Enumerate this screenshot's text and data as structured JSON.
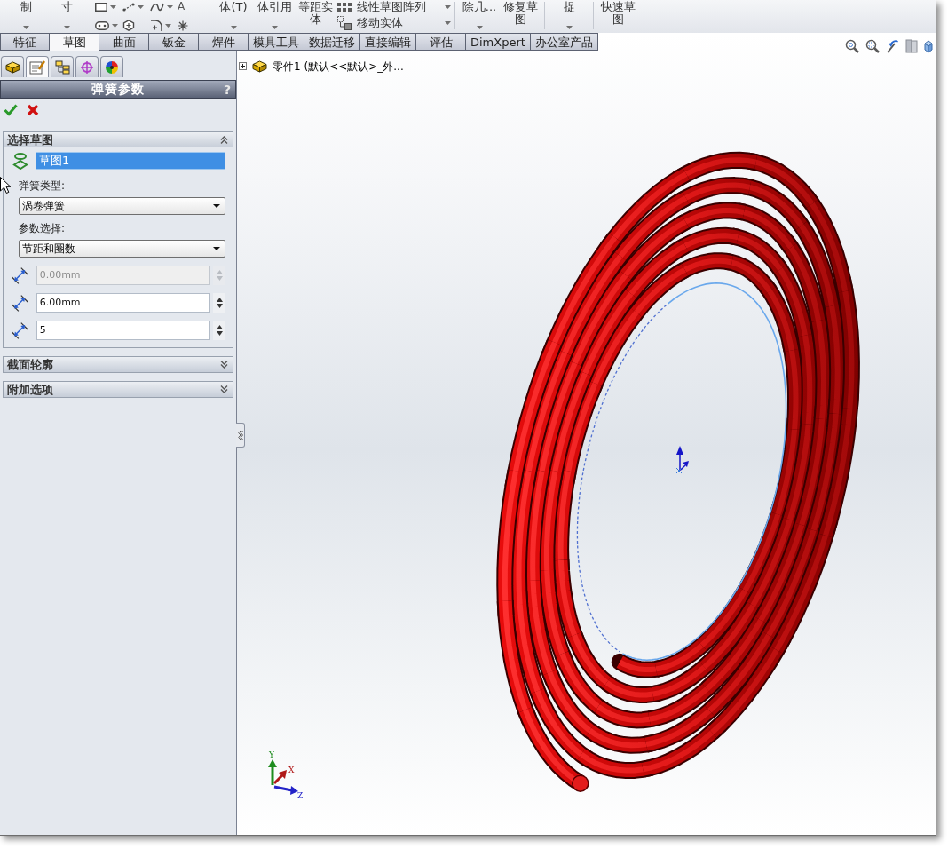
{
  "ribbon": [
    {
      "kind": "large",
      "label": "制",
      "caret": true
    },
    {
      "kind": "large",
      "label": "寸",
      "caret": true
    },
    {
      "kind": "separator"
    },
    {
      "kind": "icon_grid",
      "cells": [
        {
          "caret": true
        },
        {
          "caret": true
        },
        {
          "caret": true
        },
        {
          "caret": false,
          "glyph": "A"
        },
        {
          "caret": true
        },
        {
          "caret": false
        },
        {
          "caret": true
        },
        {
          "caret": false
        }
      ]
    },
    {
      "kind": "separator"
    },
    {
      "kind": "large",
      "label": "体(T)",
      "caret": true
    },
    {
      "kind": "large",
      "label": "体引用",
      "caret": true
    },
    {
      "kind": "large",
      "label": "等距实体",
      "caret": false
    },
    {
      "kind": "list",
      "items": [
        {
          "label": "线性草图阵列",
          "caret": true
        },
        {
          "label": "移动实体",
          "caret": true
        }
      ]
    },
    {
      "kind": "separator"
    },
    {
      "kind": "large",
      "label": "除几...",
      "caret": true
    },
    {
      "kind": "large",
      "label": "修复草图",
      "caret": false
    },
    {
      "kind": "separator"
    },
    {
      "kind": "large",
      "label": "捉",
      "caret": true
    },
    {
      "kind": "separator"
    },
    {
      "kind": "large",
      "label": "快速草图",
      "caret": false
    }
  ],
  "command_tabs": [
    {
      "label": "特征",
      "selected": false
    },
    {
      "label": "草图",
      "selected": true
    },
    {
      "label": "曲面",
      "selected": false
    },
    {
      "label": "钣金",
      "selected": false
    },
    {
      "label": "焊件",
      "selected": false
    },
    {
      "label": "模具工具",
      "selected": false
    },
    {
      "label": "数据迁移",
      "selected": false
    },
    {
      "label": "直接编辑",
      "selected": false
    },
    {
      "label": "评估",
      "selected": false
    },
    {
      "label": "DimXpert",
      "selected": false
    },
    {
      "label": "办公室产品",
      "selected": false
    }
  ],
  "panel": {
    "tabs": [
      {
        "selected": false
      },
      {
        "selected": true
      },
      {
        "selected": false
      },
      {
        "selected": false
      },
      {
        "selected": false
      }
    ],
    "title": "弹簧参数",
    "help": "?",
    "sections": [
      {
        "title": "选择草图",
        "expanded": true,
        "fields": [
          {
            "kind": "sketch",
            "value": "草图1",
            "selected": true
          },
          {
            "kind": "select",
            "label": "弹簧类型:",
            "value": "涡卷弹簧"
          },
          {
            "kind": "select",
            "label": "参数选择:",
            "value": "节距和圈数"
          },
          {
            "kind": "number",
            "value": "0.00mm",
            "disabled": true
          },
          {
            "kind": "number",
            "value": "6.00mm",
            "disabled": false
          },
          {
            "kind": "number",
            "value": "5",
            "disabled": false
          }
        ]
      },
      {
        "title": "截面轮廓",
        "expanded": false
      },
      {
        "title": "附加选项",
        "expanded": false
      }
    ]
  },
  "viewport": {
    "tree": {
      "label": "零件1 (默认<<默认>_外...",
      "expanded": false
    },
    "triad": [
      {
        "label": "Y",
        "color": "#1e8c1e"
      },
      {
        "label": "X",
        "color": "#b01818"
      },
      {
        "label": "Z",
        "color": "#2323c8"
      }
    ]
  }
}
